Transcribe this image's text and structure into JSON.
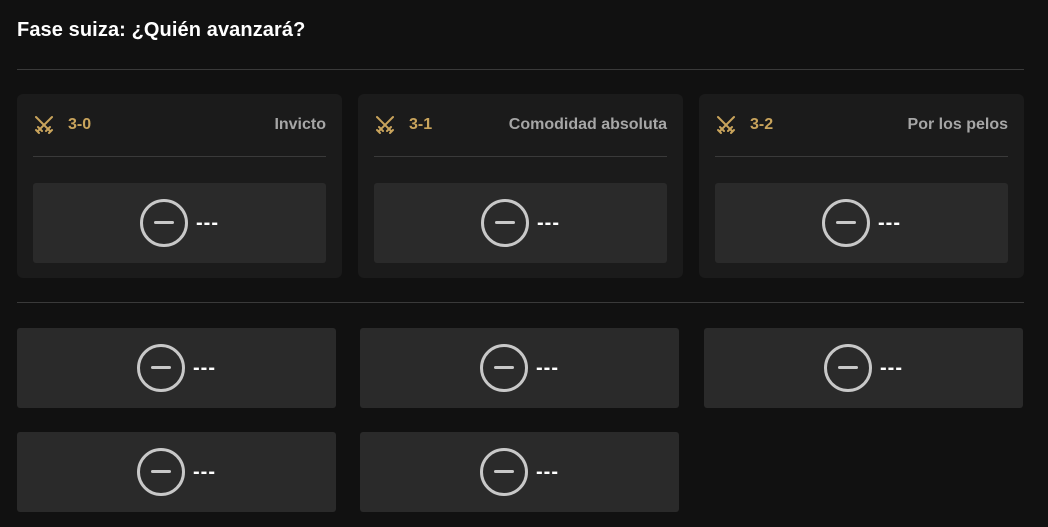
{
  "page": {
    "title": "Fase suiza: ¿Quién avanzará?"
  },
  "colors": {
    "background": "#111111",
    "card": "#1b1b1b",
    "slot": "#2a2a2a",
    "accent_gold": "#c9a45c",
    "muted_text": "#a6a6a6"
  },
  "record_groups": [
    {
      "icon": "crossed-swords-icon",
      "record": "3-0",
      "tag": "Invicto",
      "slot_label": "---"
    },
    {
      "icon": "crossed-swords-icon",
      "record": "3-1",
      "tag": "Comodidad absoluta",
      "slot_label": "---"
    },
    {
      "icon": "crossed-swords-icon",
      "record": "3-2",
      "tag": "Por los pelos",
      "slot_label": "---"
    }
  ],
  "advance_slots": [
    {
      "icon": "minus-circle-icon",
      "label": "---"
    },
    {
      "icon": "minus-circle-icon",
      "label": "---"
    },
    {
      "icon": "minus-circle-icon",
      "label": "---"
    },
    {
      "icon": "minus-circle-icon",
      "label": "---"
    },
    {
      "icon": "minus-circle-icon",
      "label": "---"
    }
  ]
}
